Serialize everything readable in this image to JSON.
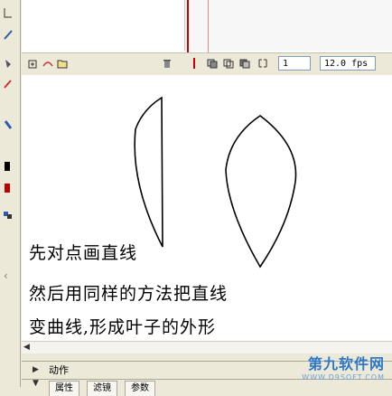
{
  "timeline": {
    "current_frame": "1",
    "fps": "12.0 fps"
  },
  "captions": {
    "line1": "先对点画直线",
    "line2": "然后用同样的方法把直线",
    "line3": "变曲线,形成叶子的外形"
  },
  "panels": {
    "actions_label": "动作",
    "tabs": [
      "属性",
      "滤镜",
      "参数"
    ]
  },
  "watermark": {
    "title": "第九软件网",
    "url": "WWW.D9SOFT.COM"
  },
  "colors": {
    "chrome": "#ece9d8",
    "stage": "#ffffff",
    "playhead": "#cc0000"
  }
}
